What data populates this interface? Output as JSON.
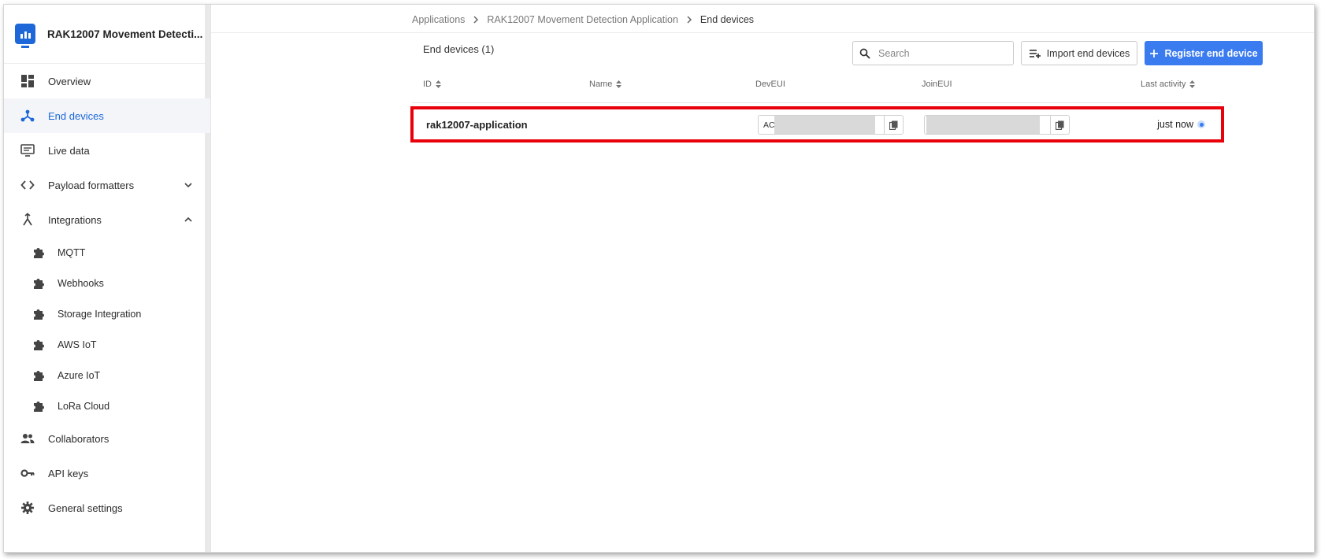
{
  "app": {
    "title": "RAK12007 Movement Detecti..."
  },
  "sidebar": {
    "items": [
      {
        "label": "Overview",
        "icon": "dashboard-icon"
      },
      {
        "label": "End devices",
        "icon": "end-devices-icon",
        "active": true
      },
      {
        "label": "Live data",
        "icon": "live-data-icon"
      },
      {
        "label": "Payload formatters",
        "icon": "code-icon",
        "expand": "collapsed"
      },
      {
        "label": "Integrations",
        "icon": "integrations-icon",
        "expand": "expanded"
      },
      {
        "label": "Collaborators",
        "icon": "people-icon"
      },
      {
        "label": "API keys",
        "icon": "key-icon"
      },
      {
        "label": "General settings",
        "icon": "gear-icon"
      }
    ],
    "integrations": [
      {
        "label": "MQTT",
        "icon": "puzzle-icon"
      },
      {
        "label": "Webhooks",
        "icon": "puzzle-icon"
      },
      {
        "label": "Storage Integration",
        "icon": "puzzle-icon"
      },
      {
        "label": "AWS IoT",
        "icon": "puzzle-icon"
      },
      {
        "label": "Azure IoT",
        "icon": "puzzle-icon"
      },
      {
        "label": "LoRa Cloud",
        "icon": "puzzle-icon"
      }
    ]
  },
  "breadcrumb": {
    "items": [
      "Applications",
      "RAK12007 Movement Detection Application",
      "End devices"
    ]
  },
  "toolbar": {
    "title": "End devices (1)",
    "search_placeholder": "Search",
    "import_label": "Import end devices",
    "register_label": "Register end device"
  },
  "table": {
    "columns": {
      "id": "ID",
      "name": "Name",
      "deveui": "DevEUI",
      "joineui": "JoinEUI",
      "last_activity": "Last activity"
    },
    "rows": [
      {
        "id": "rak12007-application",
        "name": "",
        "deveui_prefix": "AC",
        "joineui_prefix": "",
        "last_activity": "just now"
      }
    ]
  },
  "colors": {
    "accent": "#3a7bf0",
    "highlight": "#e8000b",
    "active_nav": "#1d67d8"
  }
}
